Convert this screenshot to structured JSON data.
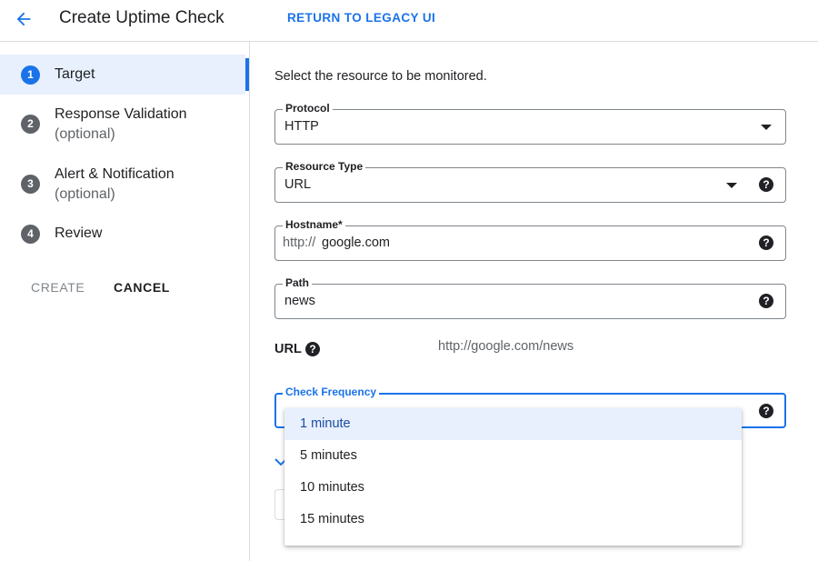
{
  "header": {
    "title": "Create Uptime Check",
    "legacy_link": "RETURN TO LEGACY UI",
    "back_icon": "arrow-left-icon"
  },
  "sidebar": {
    "steps": [
      {
        "number": "1",
        "label": "Target",
        "sub": "",
        "active": true
      },
      {
        "number": "2",
        "label": "Response Validation",
        "sub": "(optional)",
        "active": false
      },
      {
        "number": "3",
        "label": "Alert & Notification",
        "sub": "(optional)",
        "active": false
      },
      {
        "number": "4",
        "label": "Review",
        "sub": "",
        "active": false
      }
    ],
    "create_label": "CREATE",
    "cancel_label": "CANCEL"
  },
  "main": {
    "description": "Select the resource to be monitored.",
    "protocol": {
      "label": "Protocol",
      "value": "HTTP"
    },
    "resource_type": {
      "label": "Resource Type",
      "value": "URL"
    },
    "hostname": {
      "label": "Hostname*",
      "prefix": "http://",
      "value": "google.com"
    },
    "path": {
      "label": "Path",
      "value": "news"
    },
    "url": {
      "label": "URL",
      "value": "http://google.com/news"
    },
    "check_frequency": {
      "label": "Check Frequency",
      "value": ""
    }
  },
  "dropdown": {
    "options": [
      "1 minute",
      "5 minutes",
      "10 minutes",
      "15 minutes"
    ],
    "selected": "1 minute"
  },
  "colors": {
    "accent": "#1a73e8",
    "selected_bg": "#e8f0fe",
    "text": "#202124",
    "muted": "#5f6368"
  }
}
